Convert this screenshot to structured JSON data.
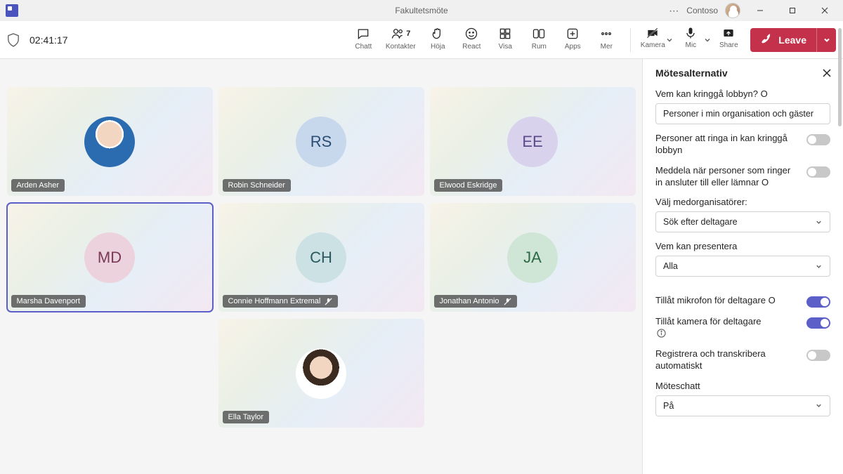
{
  "titlebar": {
    "title": "Fakultetsmöte",
    "org": "Contoso",
    "logo_name": "teams-logo"
  },
  "toolbar": {
    "timer": "02:41:17",
    "buttons": {
      "chat": "Chatt",
      "people": "Kontakter",
      "people_count": "7",
      "raise": "Höja",
      "react": "React",
      "view": "Visa",
      "rooms": "Rum",
      "apps": "Apps",
      "more": "Mer",
      "camera": "Kamera",
      "mic": "Mic",
      "share": "Share"
    },
    "leave": "Leave"
  },
  "participants": [
    {
      "name": "Arden Asher",
      "initials": "",
      "photo": "p1",
      "muted": false,
      "selected": false
    },
    {
      "name": "Robin Schneider",
      "initials": "RS",
      "color": "c-blue",
      "muted": false,
      "selected": false
    },
    {
      "name": "Elwood Eskridge",
      "initials": "EE",
      "color": "c-lilac",
      "muted": false,
      "selected": false
    },
    {
      "name": "Marsha Davenport",
      "initials": "MD",
      "color": "c-pink",
      "muted": false,
      "selected": true
    },
    {
      "name": "Connie Hoffmann Extremal",
      "initials": "CH",
      "color": "c-teal",
      "muted": true,
      "selected": false
    },
    {
      "name": "Jonathan Antonio",
      "initials": "JA",
      "color": "c-green",
      "muted": true,
      "selected": false
    },
    {
      "name": "Ella Taylor",
      "initials": "",
      "photo": "p2",
      "muted": false,
      "selected": false
    }
  ],
  "panel": {
    "title": "Mötesalternativ",
    "lobby_label": "Vem kan kringgå lobbyn? O",
    "lobby_value": "Personer i min organisation och gäster",
    "dialin_bypass_label": "Personer att ringa in kan kringgå lobbyn",
    "dialin_bypass": false,
    "announce_label": "Meddela när personer som ringer in ansluter till eller lämnar O",
    "announce": false,
    "coorganizers_label": "Välj medorganisatörer:",
    "coorganizers_value": "Sök efter deltagare",
    "presenter_label": "Vem kan presentera",
    "presenter_value": "Alla",
    "allow_mic_label": "Tillåt mikrofon för deltagare O",
    "allow_mic": true,
    "allow_cam_label": "Tillåt kamera för deltagare",
    "allow_cam": true,
    "record_label": "Registrera och transkribera automatiskt",
    "record": false,
    "chat_label": "Möteschatt",
    "chat_value": "På"
  }
}
